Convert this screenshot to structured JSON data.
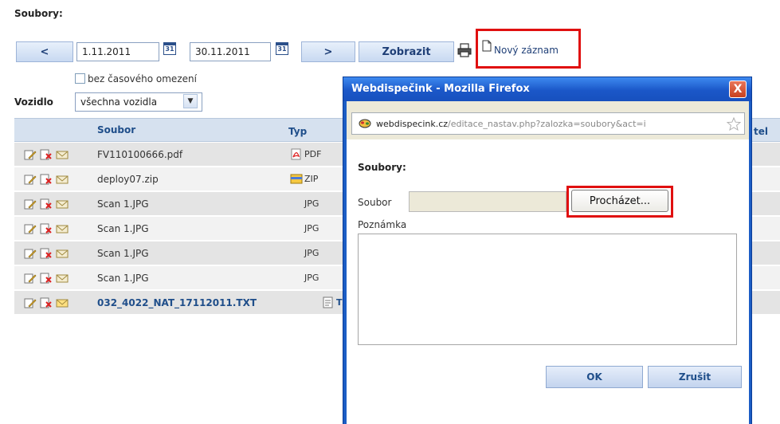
{
  "page": {
    "title": "Soubory:"
  },
  "toolbar": {
    "prev_label": "<",
    "date_from": "1.11.2011",
    "date_to": "30.11.2011",
    "calendar_icon_text": "31",
    "next_label": ">",
    "show_label": "Zobrazit",
    "new_record_label": "Nový záznam",
    "no_time_limit_label": "bez časového omezení"
  },
  "vehicle": {
    "label": "Vozidlo",
    "selected": "všechna vozidla"
  },
  "table": {
    "headers": {
      "file": "Soubor",
      "type": "Typ",
      "partial_right": "tel"
    },
    "rows": [
      {
        "file": "FV110100666.pdf",
        "type": "PDF",
        "icon": "pdf-icon",
        "bold": false
      },
      {
        "file": "deploy07.zip",
        "type": "ZIP",
        "icon": "zip-icon",
        "bold": false
      },
      {
        "file": "Scan 1.JPG",
        "type": "JPG",
        "icon": "",
        "bold": false
      },
      {
        "file": "Scan 1.JPG",
        "type": "JPG",
        "icon": "",
        "bold": false
      },
      {
        "file": "Scan 1.JPG",
        "type": "JPG",
        "icon": "",
        "bold": false
      },
      {
        "file": "Scan 1.JPG",
        "type": "JPG",
        "icon": "",
        "bold": false
      },
      {
        "file": "032_4022_NAT_17112011.TXT",
        "type": "TXT",
        "icon": "txt-icon",
        "bold": true
      }
    ]
  },
  "popup": {
    "window_title": "Webdispečink - Mozilla Firefox",
    "close_label": "X",
    "url_domain": "webdispecink.cz",
    "url_path": "/editace_nastav.php?zalozka=soubory&act=i",
    "heading": "Soubory:",
    "file_label": "Soubor",
    "browse_label": "Procházet...",
    "note_label": "Poznámka",
    "ok_label": "OK",
    "cancel_label": "Zrušit"
  },
  "colors": {
    "highlight": "#e01010",
    "header_bg": "#d6e1ef",
    "window_blue": "#1c5dc5"
  }
}
